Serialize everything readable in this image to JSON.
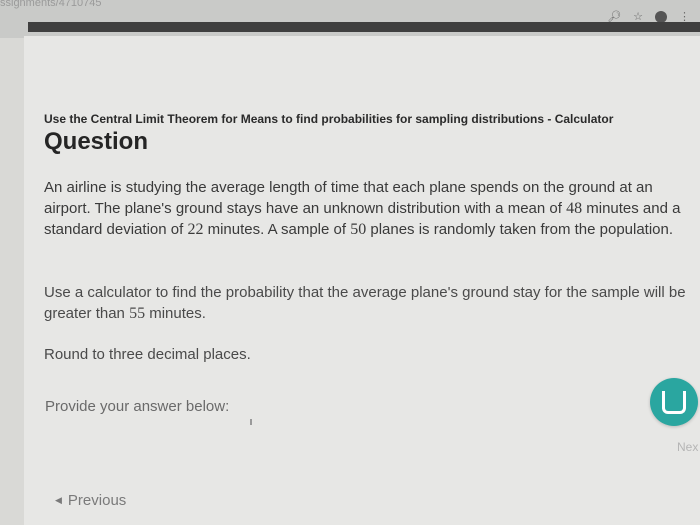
{
  "browser": {
    "url_fragment": "ssignments/4710745",
    "icons": [
      "zoom-icon",
      "star-icon",
      "extension-icon",
      "menu-icon"
    ]
  },
  "header": {
    "breadcrumb": "Use the Central Limit Theorem for Means to find probabilities for sampling distributions - Calculator",
    "title": "Question"
  },
  "problem": {
    "part1": "An airline is studying the average length of time that each plane spends on the ground at an airport. The plane's ground stays have an unknown distribution with a mean of ",
    "mean": "48",
    "part2": " minutes and a standard deviation of ",
    "sd": "22",
    "part3": " minutes. A sample of ",
    "n": "50",
    "part4": " planes is randomly taken from the population."
  },
  "instruction": {
    "part1": "Use a calculator to find the probability that the average plane's ground stay for the sample will be greater than ",
    "threshold": "55",
    "part2": " minutes."
  },
  "rounding": "Round to three decimal places.",
  "answer_label": "Provide your answer below:",
  "nav": {
    "previous": "Previous",
    "next": "Nex"
  },
  "colors": {
    "accent": "#2aa6a0",
    "page_bg": "#e7e7e5",
    "title": "#252525"
  }
}
